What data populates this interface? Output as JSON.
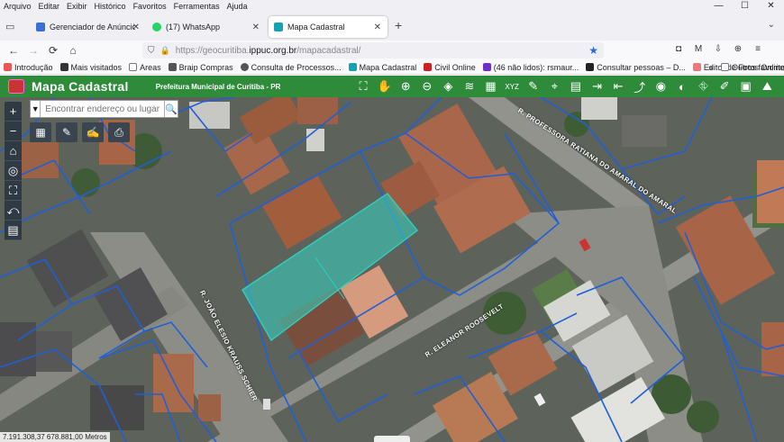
{
  "menubar": {
    "items": [
      "Arquivo",
      "Editar",
      "Exibir",
      "Histórico",
      "Favoritos",
      "Ferramentas",
      "Ajuda"
    ],
    "window_controls": [
      "—",
      "☐",
      "✕"
    ]
  },
  "tabs": [
    {
      "label": "Gerenciador de Anúncios - Gere",
      "favicon_color": "#3b6fd8",
      "close": "✕"
    },
    {
      "label": "(17) WhatsApp",
      "favicon_color": "#25d366",
      "close": "✕"
    },
    {
      "label": "Mapa Cadastral",
      "favicon_color": "#13a3b5",
      "close": "✕",
      "active": true
    }
  ],
  "new_tab": "+",
  "navbar": {
    "back": "←",
    "forward": "→",
    "reload": "⟳",
    "home": "⌂",
    "url_prefix": "https://geocuritiba.",
    "url_host": "ippuc.org.br",
    "url_path": "/mapacadastral/",
    "star": "★",
    "right_icons": [
      "◘",
      "M",
      "⇩",
      "⊕",
      "≡"
    ]
  },
  "bookmarks": [
    {
      "label": "Introdução",
      "color": "#e55"
    },
    {
      "label": "Mais visitados",
      "color": "#333"
    },
    {
      "label": "Areas",
      "color": "#aaa"
    },
    {
      "label": "Braip Compras",
      "color": "#555"
    },
    {
      "label": "Consulta de Processos...",
      "color": "#555"
    },
    {
      "label": "Mapa Cadastral",
      "color": "#13a3b5"
    },
    {
      "label": "Civil Online",
      "color": "#c22"
    },
    {
      "label": "(46 não lidos): rsmaur...",
      "color": "#6d2fc8"
    },
    {
      "label": "Consultar pessoas – D...",
      "color": "#222"
    },
    {
      "label": "Editor de Fotos Online",
      "color": "#e77"
    }
  ],
  "bookmarks_overflow": "»",
  "other_bookmarks": "Outros favoritos",
  "app": {
    "title": "Mapa Cadastral",
    "subtitle": "Prefeitura Municipal de Curitiba - PR",
    "accent": "#2e8b3a",
    "tools": [
      "map-icon",
      "pan-icon",
      "zoom-in-icon",
      "zoom-out-icon",
      "layers-icon",
      "stack-icon",
      "grid-icon",
      "xyz-icon",
      "book-icon",
      "measure-icon",
      "select-icon",
      "export-icon",
      "import-icon",
      "share-icon",
      "locate-icon",
      "globe-icon",
      "street-icon",
      "draw-icon",
      "image-icon",
      "terrain-icon",
      "info-icon"
    ],
    "tool_glyphs": [
      "⛶",
      "✋",
      "⊕",
      "⊖",
      "◈",
      "≋",
      "▦",
      "XYZ",
      "✎",
      "⌖",
      "▤",
      "⇥",
      "⇤",
      "⤴",
      "◉",
      "◐",
      "⛗",
      "✐",
      "▣",
      "⛰",
      "ℹ"
    ]
  },
  "map": {
    "search_placeholder": "Encontrar endereço ou lugar",
    "search_dropdown": "▼",
    "search_button": "🔍",
    "zoom_in": "+",
    "zoom_out": "−",
    "left_tools": [
      "⌂",
      "◎",
      "⛶",
      "⤺",
      "▤"
    ],
    "quick_tools": [
      "▦",
      "✎",
      "✍",
      "⎙"
    ],
    "coordinates": "7.191.308,37 678.881,00 Metros",
    "streets": [
      {
        "name": "R. PROFESSORA RATIANA DO AMARAL DO AMARAL"
      },
      {
        "name": "R. JOÃO ELESIO KRAUSS SCHIER"
      },
      {
        "name": "R. ELEANOR ROOSEVELT"
      }
    ],
    "highlight_color": "#35d6c4",
    "lot_line_color": "#1f5fd8"
  }
}
